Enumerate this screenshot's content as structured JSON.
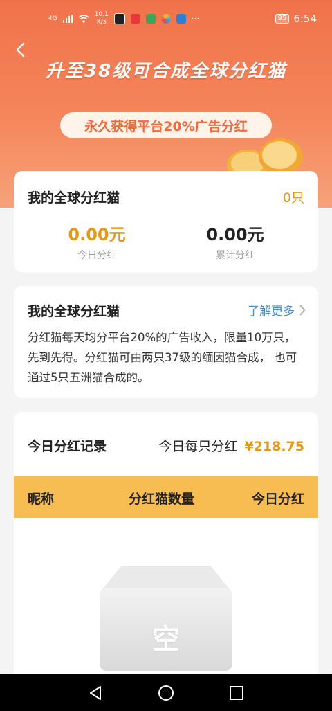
{
  "status_bar": {
    "network": "4G",
    "speed_value": "10.1",
    "speed_unit": "K/s",
    "battery": "95",
    "time": "6:54"
  },
  "header": {
    "headline": "升至38级可合成全球分红猫",
    "pill": "永久获得平台20%广告分红"
  },
  "my_cats": {
    "title": "我的全球分红猫",
    "count": "0只",
    "today_value": "0.00元",
    "today_label": "今日分红",
    "total_value": "0.00元",
    "total_label": "累计分红"
  },
  "info": {
    "title": "我的全球分红猫",
    "more_link": "了解更多",
    "description": "分红猫每天均分平台20%的广告收入，限量10万只，先到先得。分红猫可由两只37级的缅因猫合成， 也可通过5只五洲猫合成的。"
  },
  "records": {
    "title": "今日分红记录",
    "per_cat_label": "今日每只分红",
    "per_cat_value": "¥218.75",
    "columns": [
      "昵称",
      "分红猫数量",
      "今日分红"
    ],
    "empty_label": "空"
  },
  "colors": {
    "hero_top": "#f0724b",
    "accent_gold": "#e39a17",
    "table_header": "#f8bd52",
    "link_blue": "#4b8bc6"
  }
}
